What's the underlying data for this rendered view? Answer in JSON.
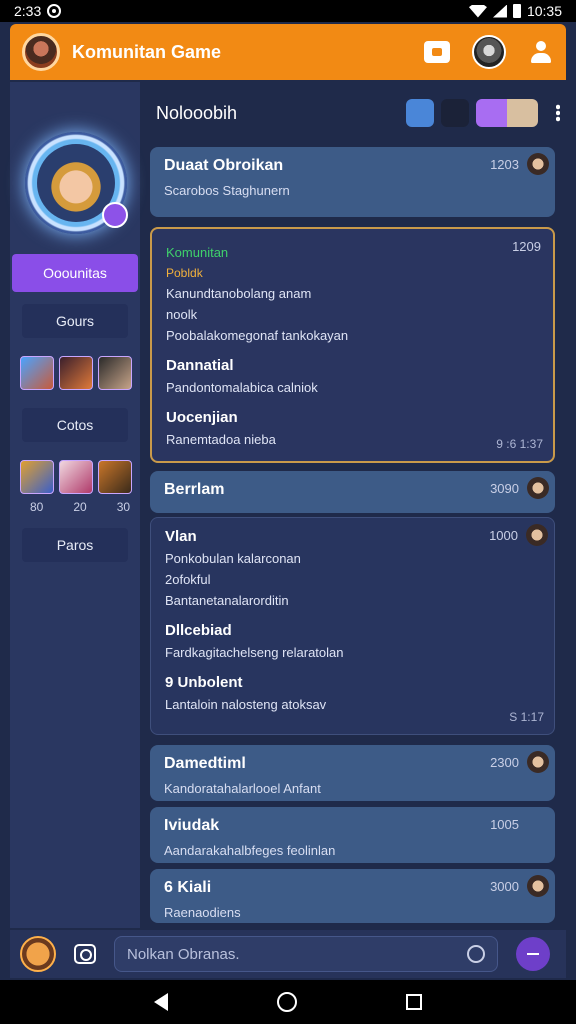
{
  "status": {
    "time": "2:33",
    "right_time": "10:35"
  },
  "header": {
    "title": "Komunitan Game"
  },
  "sidebar": {
    "active": "Ooounitas",
    "buttons": [
      "Gours",
      "Cotos",
      "Paros"
    ],
    "thumb_nums": [
      "80",
      "20",
      "30"
    ]
  },
  "main": {
    "title": "Nolooobih"
  },
  "cards": [
    {
      "title": "Duaat Obroikan",
      "sub": "Scarobos Staghunern",
      "time": "1203"
    },
    {
      "kicker": "Komunitan",
      "label": "Pobldk",
      "lines": [
        "Kanundtanobolang anam",
        "noolk",
        "Poobalakomegonaf tankokayan"
      ],
      "h2": "Dannatial",
      "l2": "Pandontomalabica calniok",
      "h3": "Uocenjian",
      "l3": "Ranemtadoa nieba",
      "time": "1209",
      "corner": "9 :6 1:37"
    },
    {
      "title": "Berrlam",
      "time": "3090"
    },
    {
      "h1": "Vlan",
      "l1a": "Ponkobulan kalarconan",
      "l1b": "2ofokful",
      "l1c": "Bantanetanalarorditin",
      "h2": "Dllcebiad",
      "l2": "Fardkagitachelseng relaratolan",
      "h3": "9 Unbolent",
      "l3": "Lantaloin nalosteng atoksav",
      "time": "1000",
      "corner": "S 1:17"
    },
    {
      "title": "Damedtiml",
      "sub": "Kandoratahalarlooel Anfant",
      "time": "2300"
    },
    {
      "title": "Iviudak",
      "sub": "Aandarakahalbfeges feolinlan",
      "time": "1005"
    },
    {
      "title": "6 Kiali",
      "sub": "Raenaodiens",
      "time": "3000"
    }
  ],
  "composer": {
    "placeholder": "Nolkan Obranas."
  }
}
